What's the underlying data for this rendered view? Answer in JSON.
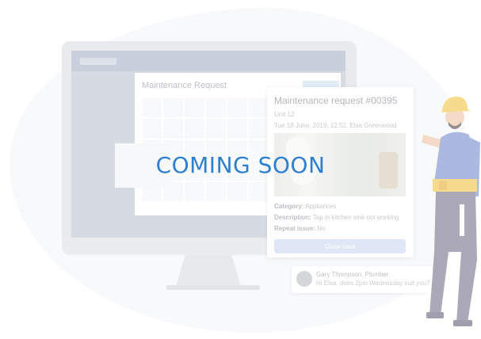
{
  "overlay": {
    "label": "COMING SOON"
  },
  "monitor_panel": {
    "title": "Maintenance Request"
  },
  "request_card": {
    "title": "Maintenance request #00395",
    "unit": "Unit 12",
    "date_line": "Tue 18 June, 2019, 12:52, Elsa Greenwood",
    "category_label": "Category:",
    "category_value": "Appliances",
    "description_label": "Description:",
    "description_value": "Tap in kitchen sink not working",
    "repeat_label": "Repeat issue:",
    "repeat_value": "No",
    "close_button": "Close case"
  },
  "chat": {
    "name": "Gary Thompson, Plumber",
    "message": "Hi Elsa, does 2pm Wednesday suit you?"
  },
  "colors": {
    "accent": "#2f7fd1",
    "button_bg": "#c8d6ef",
    "helmet": "#f2c23a",
    "shirt": "#6f86c9",
    "pants": "#6f6c86"
  }
}
